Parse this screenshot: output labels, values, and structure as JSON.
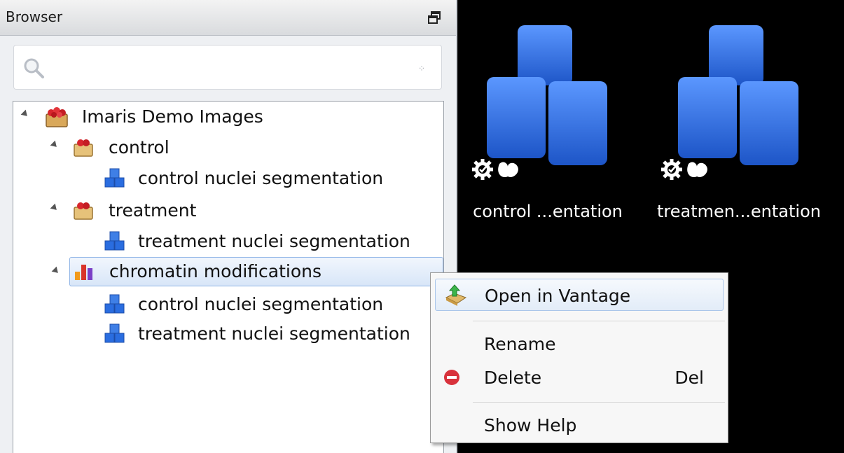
{
  "browser": {
    "title": "Browser",
    "search": {
      "placeholder": ""
    }
  },
  "tree": {
    "root": {
      "label": "Imaris Demo Images",
      "icon": "demo-box-icon"
    },
    "groups": [
      {
        "label": "control",
        "icon": "folder-box-icon",
        "children": [
          "control nuclei segmentation"
        ]
      },
      {
        "label": "treatment",
        "icon": "folder-box-icon",
        "children": [
          "treatment nuclei segmentation"
        ]
      },
      {
        "label": "chromatin modifications",
        "icon": "bar-chart-icon",
        "selected": true,
        "children": [
          "control nuclei segmentation",
          "treatment nuclei segmentation"
        ]
      }
    ]
  },
  "items": [
    {
      "caption": "control ...entation",
      "icon": "blue-cubes-icon"
    },
    {
      "caption": "treatmen...entation",
      "icon": "blue-cubes-icon"
    }
  ],
  "context_menu": {
    "items": [
      {
        "label": "Open in Vantage",
        "icon": "open-vantage-icon",
        "shortcut": ""
      },
      {
        "label": "Rename",
        "icon": "",
        "shortcut": ""
      },
      {
        "label": "Delete",
        "icon": "delete-icon",
        "shortcut": "Del"
      },
      {
        "label": "Show Help",
        "icon": "",
        "shortcut": ""
      }
    ]
  },
  "colors": {
    "selection": "#d8e6f8",
    "cube": "#2a6de0",
    "delete": "#d8323c"
  }
}
